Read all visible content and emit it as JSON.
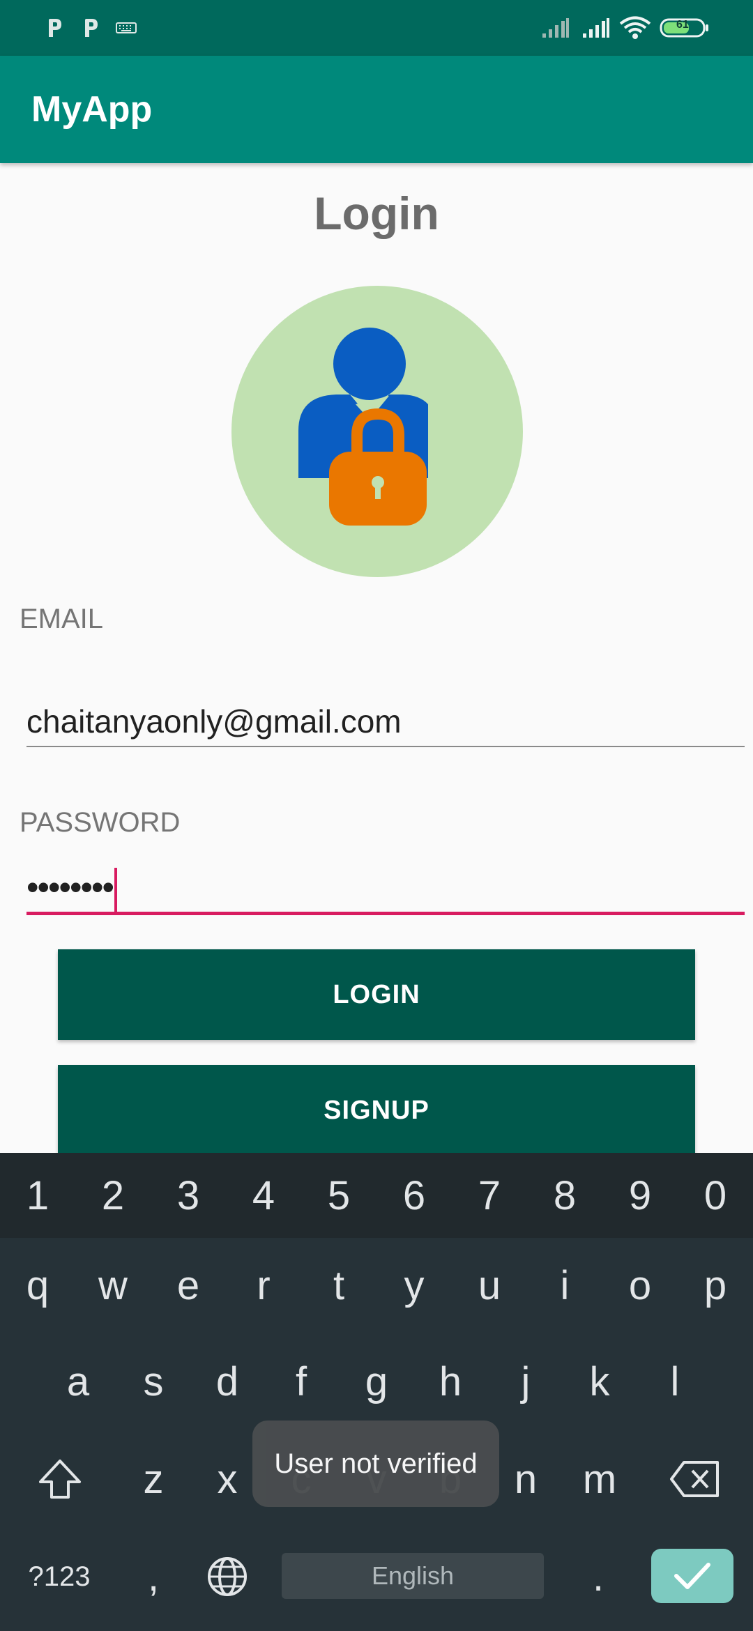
{
  "status_bar": {
    "left_icons": [
      "parking-icon",
      "parking-icon",
      "keyboard-icon"
    ],
    "battery_level": "61"
  },
  "app_bar": {
    "title": "MyApp"
  },
  "login": {
    "title": "Login",
    "email_label": "EMAIL",
    "email_value": "chaitanyaonly@gmail.com",
    "password_label": "PASSWORD",
    "password_value": "••••••••",
    "login_button": "LOGIN",
    "signup_button": "SIGNUP"
  },
  "colors": {
    "status_bar": "#00695c",
    "app_bar": "#00897b",
    "button": "#00574b",
    "accent": "#d81b60",
    "avatar_bg": "#c1e1b1",
    "user_blue": "#0a5dc2",
    "lock_orange": "#ea7700"
  },
  "keyboard": {
    "number_row": [
      "1",
      "2",
      "3",
      "4",
      "5",
      "6",
      "7",
      "8",
      "9",
      "0"
    ],
    "row1": [
      "q",
      "w",
      "e",
      "r",
      "t",
      "y",
      "u",
      "i",
      "o",
      "p"
    ],
    "row2": [
      "a",
      "s",
      "d",
      "f",
      "g",
      "h",
      "j",
      "k",
      "l"
    ],
    "row3": [
      "z",
      "x",
      "c",
      "v",
      "b",
      "n",
      "m"
    ],
    "symbols_key": "?123",
    "comma_key": ",",
    "space_label": "English",
    "period_key": "."
  },
  "toast": {
    "message": "User not verified"
  }
}
